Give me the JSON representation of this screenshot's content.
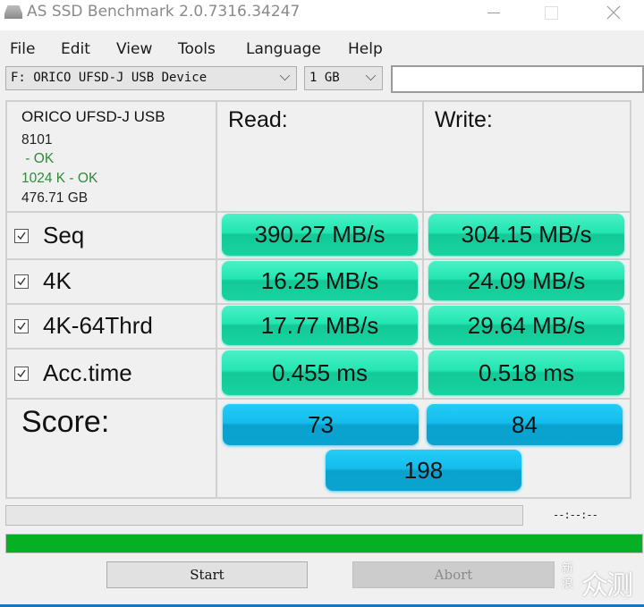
{
  "window": {
    "title": "AS SSD Benchmark 2.0.7316.34247",
    "icon": "drive-icon",
    "controls": [
      "minimize",
      "maximize",
      "close"
    ]
  },
  "menu": {
    "items": [
      "File",
      "Edit",
      "View",
      "Tools",
      "Language",
      "Help"
    ]
  },
  "toolbar": {
    "drive_select": "F: ORICO UFSD-J USB Device",
    "size_select": "1 GB",
    "text_input_value": ""
  },
  "device_info": {
    "name": "ORICO UFSD-J USB",
    "firmware": "8101",
    "driver_status": " - OK",
    "alignment_status": "1024 K - OK",
    "capacity": "476.71 GB",
    "ok_color": "#2e8b3a"
  },
  "headers": {
    "read": "Read:",
    "write": "Write:"
  },
  "tests": [
    {
      "label": "Seq",
      "checked": true,
      "read": "390.27 MB/s",
      "write": "304.15 MB/s"
    },
    {
      "label": "4K",
      "checked": true,
      "read": "16.25 MB/s",
      "write": "24.09 MB/s"
    },
    {
      "label": "4K-64Thrd",
      "checked": true,
      "read": "17.77 MB/s",
      "write": "29.64 MB/s"
    },
    {
      "label": "Acc.time",
      "checked": true,
      "read": "0.455 ms",
      "write": "0.518 ms"
    }
  ],
  "score": {
    "label": "Score:",
    "read": "73",
    "write": "84",
    "total": "198"
  },
  "status": {
    "time_readout": "--:--:--",
    "test_progress_percent": 0,
    "overall_progress_percent": 100,
    "progress_color": "#06b025"
  },
  "buttons": {
    "start": "Start",
    "abort": "Abort"
  },
  "watermark": {
    "small": "新浪",
    "big": "众测"
  },
  "colors": {
    "result_green": "#1fdfac",
    "score_blue": "#13bdec"
  }
}
